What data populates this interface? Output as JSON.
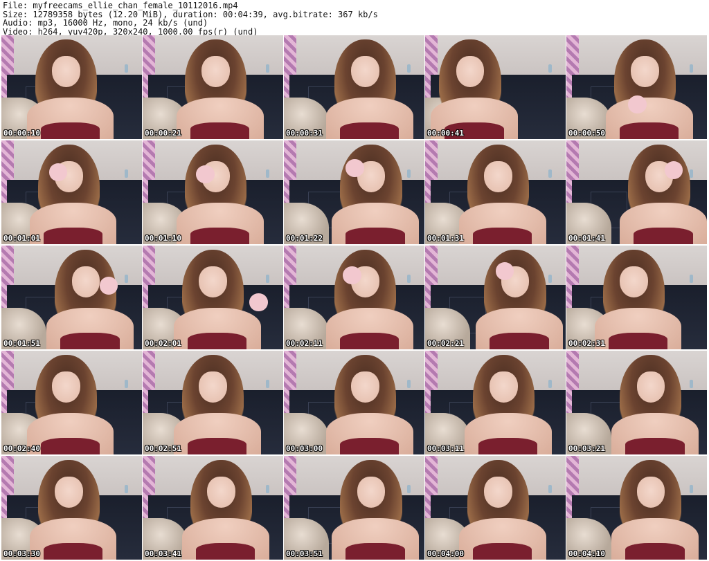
{
  "header": {
    "file": "File: myfreecams_ellie_chan_female_10112016.mp4",
    "size": "Size: 12789358 bytes (12.20 MiB), duration: 00:04:39, avg.bitrate: 367 kb/s",
    "audio": "Audio: mp3, 16000 Hz, mono, 24 kb/s (und)",
    "video": "Video: h264, yuv420p, 320x240, 1000.00 fps(r) (und)"
  },
  "thumbnails": [
    {
      "timestamp": "00:00:10"
    },
    {
      "timestamp": "00:00:21"
    },
    {
      "timestamp": "00:00:31"
    },
    {
      "timestamp": "00:00:41"
    },
    {
      "timestamp": "00:00:50"
    },
    {
      "timestamp": "00:01:01"
    },
    {
      "timestamp": "00:01:10"
    },
    {
      "timestamp": "00:01:22"
    },
    {
      "timestamp": "00:01:31"
    },
    {
      "timestamp": "00:01:41"
    },
    {
      "timestamp": "00:01:51"
    },
    {
      "timestamp": "00:02:01"
    },
    {
      "timestamp": "00:02:11"
    },
    {
      "timestamp": "00:02:21"
    },
    {
      "timestamp": "00:02:31"
    },
    {
      "timestamp": "00:02:40"
    },
    {
      "timestamp": "00:02:51"
    },
    {
      "timestamp": "00:03:00"
    },
    {
      "timestamp": "00:03:11"
    },
    {
      "timestamp": "00:03:21"
    },
    {
      "timestamp": "00:03:30"
    },
    {
      "timestamp": "00:03:41"
    },
    {
      "timestamp": "00:03:51"
    },
    {
      "timestamp": "00:04:00"
    },
    {
      "timestamp": "00:04:10"
    }
  ]
}
